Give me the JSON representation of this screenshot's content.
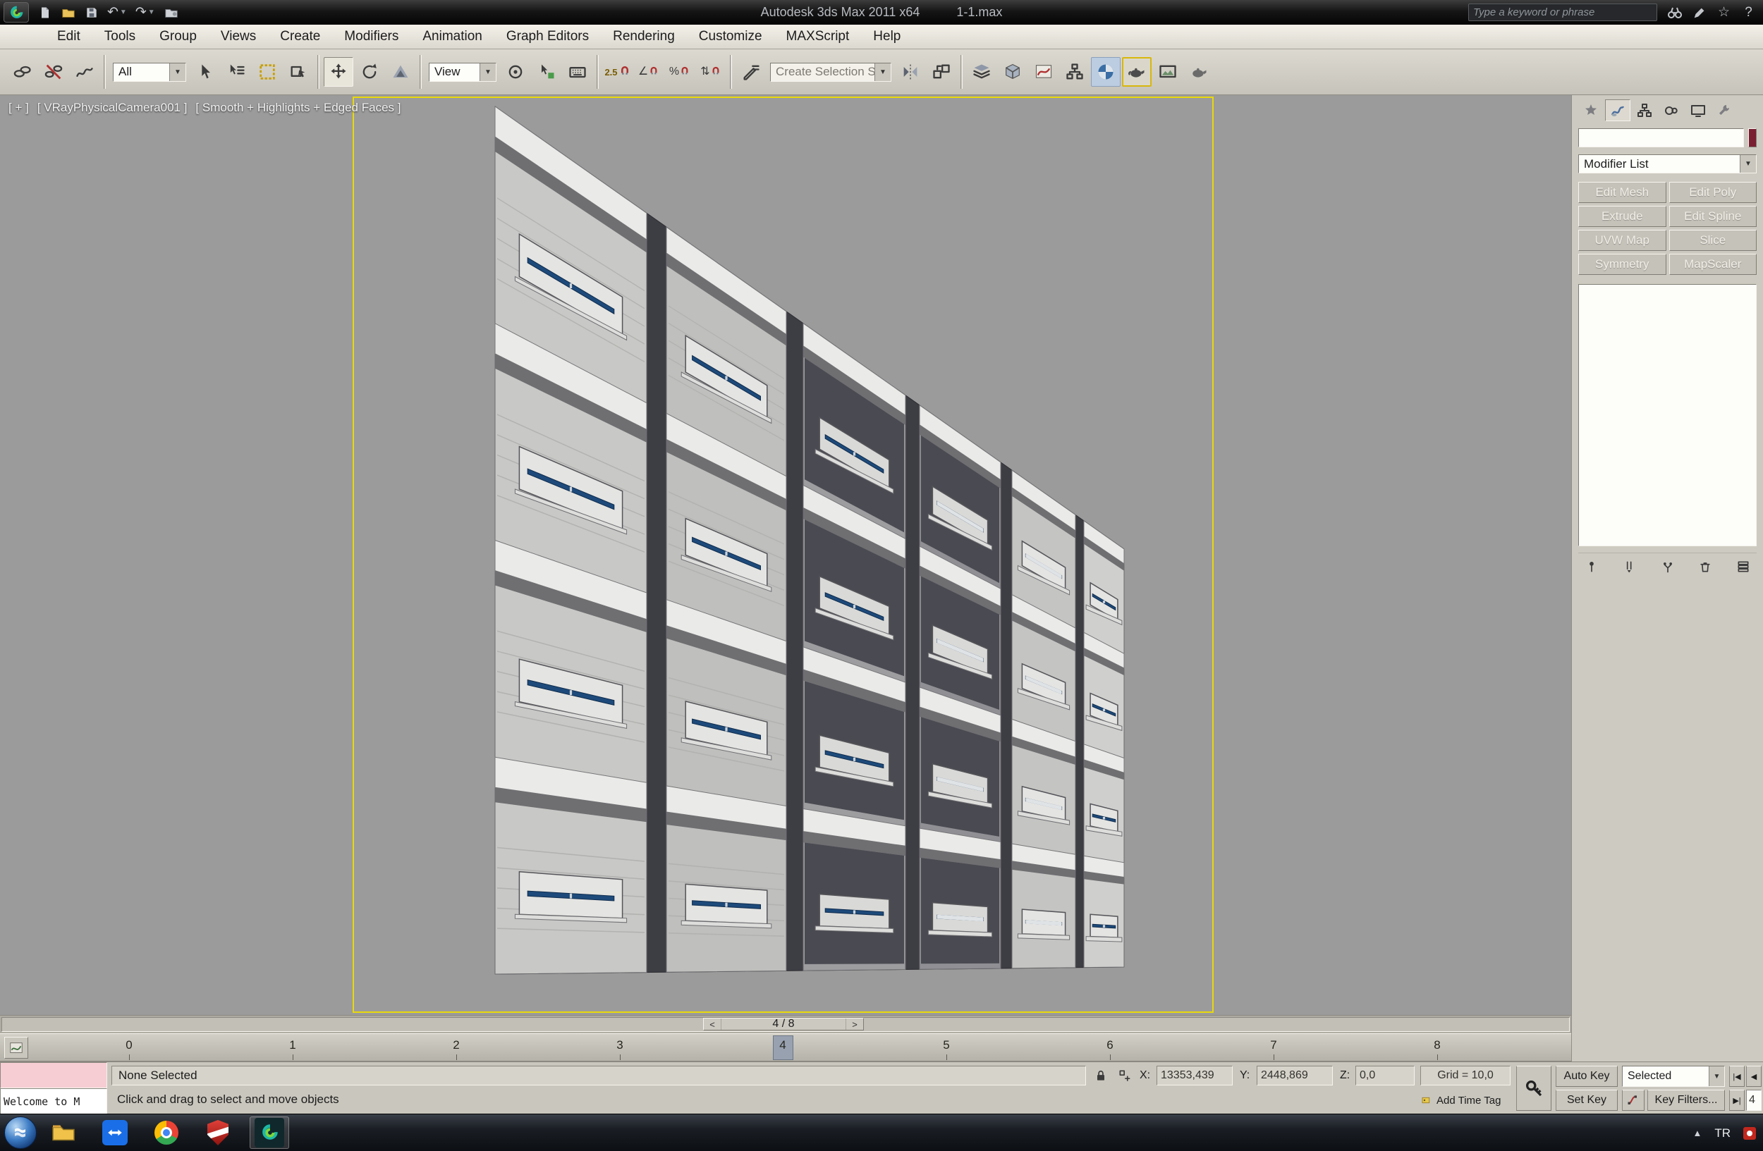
{
  "window": {
    "app_title": "Autodesk 3ds Max 2011 x64",
    "file_name": "1-1.max",
    "search_placeholder": "Type a keyword or phrase"
  },
  "menus": [
    "Edit",
    "Tools",
    "Group",
    "Views",
    "Create",
    "Modifiers",
    "Animation",
    "Graph Editors",
    "Rendering",
    "Customize",
    "MAXScript",
    "Help"
  ],
  "toolbar": {
    "selection_filter_value": "All",
    "coordinate_system_value": "View",
    "named_selection_placeholder": "Create Selection Se",
    "snap_value": "2.5"
  },
  "viewport": {
    "label_plus": "[ + ]",
    "label_camera": "[ VRayPhysicalCamera001 ]",
    "label_shading": "[ Smooth + Highlights + Edged Faces ]"
  },
  "command_panel": {
    "object_name_value": "",
    "modifier_list_label": "Modifier List",
    "modifier_buttons": [
      "Edit Mesh",
      "Edit Poly",
      "Extrude",
      "Edit Spline",
      "UVW Map",
      "Slice",
      "Symmetry",
      "MapScaler"
    ],
    "object_color": "#7a2033"
  },
  "timeline": {
    "slider_prev": "<",
    "slider_label": "4 / 8",
    "slider_next": ">",
    "ticks": [
      "0",
      "1",
      "2",
      "3",
      "4",
      "5",
      "6",
      "7",
      "8"
    ]
  },
  "status_bar": {
    "macro_recorder_text": "",
    "listener_text": "Welcome to M",
    "selection_status": "None Selected",
    "prompt_text": "Click and drag to select and move objects",
    "coord_x_label": "X:",
    "coord_x_value": "13353,439",
    "coord_y_label": "Y:",
    "coord_y_value": "2448,869",
    "coord_z_label": "Z:",
    "coord_z_value": "0,0",
    "grid_label": "Grid = 10,0",
    "add_time_tag_label": "Add Time Tag",
    "auto_key_label": "Auto Key",
    "set_key_label": "Set Key",
    "key_mode_value": "Selected",
    "key_filters_label": "Key Filters...",
    "frame_value": "4"
  },
  "taskbar": {
    "language": "TR"
  },
  "icons": {
    "undo": "↶",
    "redo": "↷",
    "combo_arrow": "▼",
    "star": "☆",
    "help": "?",
    "tray_arrow": "▲",
    "goto_start": "|◀",
    "prev_frame": "◀",
    "goto_end": "▶|",
    "angle": "∠",
    "percent": "%",
    "spinner": "⇅"
  }
}
